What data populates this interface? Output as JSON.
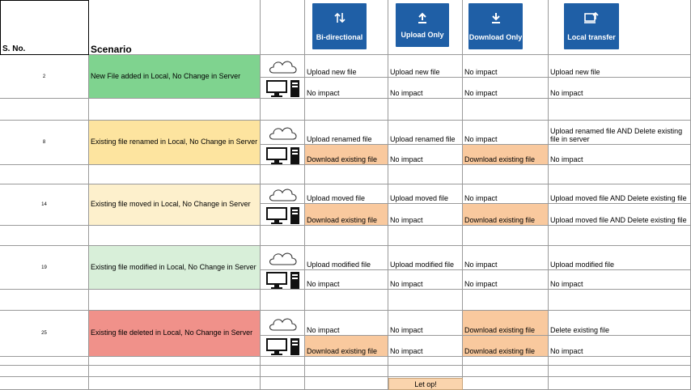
{
  "headers": {
    "sno": "S. No.",
    "scenario": "Scenario",
    "modes": [
      "Bi-directional",
      "Upload Only",
      "Download Only",
      "Local transfer"
    ]
  },
  "colors": {
    "green": "#7fd38f",
    "yellow": "#fde49f",
    "lightYellow": "#fdf0cc",
    "lightGreen": "#d8efd9",
    "red": "#f0918a",
    "orange": "#f9c99e",
    "blue": "#1f5fa6"
  },
  "rows": [
    {
      "sno": "2",
      "scenario": "New File added in Local, No Change in Server",
      "color": "green",
      "cloud": [
        "Upload new file",
        "Upload new file",
        "No impact",
        "Upload new file"
      ],
      "cloudFill": [
        "",
        "",
        "",
        ""
      ],
      "local": [
        "No impact",
        "No impact",
        "No impact",
        "No impact"
      ],
      "localFill": [
        "",
        "",
        "",
        ""
      ]
    },
    {
      "sno": "8",
      "scenario": "Existing file renamed in Local, No Change in Server",
      "color": "yellow",
      "cloud": [
        "Upload renamed file",
        "Upload renamed file",
        "No impact",
        "Upload renamed file AND Delete existing file in server"
      ],
      "cloudFill": [
        "",
        "",
        "",
        ""
      ],
      "local": [
        "Download existing file",
        "No impact",
        "Download existing file",
        "No impact"
      ],
      "localFill": [
        "orange",
        "",
        "orange",
        ""
      ]
    },
    {
      "sno": "14",
      "scenario": "Existing file moved in Local, No Change in Server",
      "color": "lightYellow",
      "cloud": [
        "Upload moved file",
        "Upload moved file",
        "No impact",
        "Upload moved file AND Delete existing file"
      ],
      "cloudFill": [
        "",
        "",
        "",
        ""
      ],
      "local": [
        "Download existing file",
        "No impact",
        "Download existing file",
        "Upload moved file AND Delete existing file"
      ],
      "localFill": [
        "orange",
        "",
        "orange",
        ""
      ]
    },
    {
      "sno": "19",
      "scenario": "Existing file modified in Local, No Change in Server",
      "color": "lightGreen",
      "cloud": [
        "Upload modified file",
        "Upload modified file",
        "No impact",
        "Upload modified file"
      ],
      "cloudFill": [
        "",
        "",
        "",
        ""
      ],
      "local": [
        "No impact",
        "No impact",
        "No impact",
        "No impact"
      ],
      "localFill": [
        "",
        "",
        "",
        ""
      ]
    },
    {
      "sno": "25",
      "scenario": "Existing file deleted in Local, No Change in Server",
      "color": "red",
      "cloud": [
        "No impact",
        "No impact",
        "Download existing file",
        "Delete existing file"
      ],
      "cloudFill": [
        "",
        "",
        "orange",
        ""
      ],
      "local": [
        "Download existing file",
        "No impact",
        "Download existing file",
        "No impact"
      ],
      "localFill": [
        "orange",
        "",
        "orange",
        ""
      ]
    }
  ],
  "footer": {
    "button": "Let op!"
  }
}
